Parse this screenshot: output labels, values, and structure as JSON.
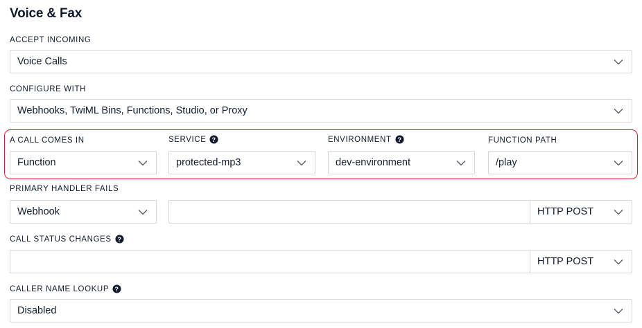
{
  "section_title": "Voice & Fax",
  "accept_incoming": {
    "label": "ACCEPT INCOMING",
    "value": "Voice Calls"
  },
  "configure_with": {
    "label": "CONFIGURE WITH",
    "value": "Webhooks, TwiML Bins, Functions, Studio, or Proxy"
  },
  "call_comes_in": {
    "label": "A CALL COMES IN",
    "value": "Function",
    "service": {
      "label": "SERVICE",
      "value": "protected-mp3"
    },
    "environment": {
      "label": "ENVIRONMENT",
      "value": "dev-environment"
    },
    "function_path": {
      "label": "FUNCTION PATH",
      "value": "/play"
    }
  },
  "primary_handler_fails": {
    "label": "PRIMARY HANDLER FAILS",
    "type": "Webhook",
    "url": "",
    "method": "HTTP POST"
  },
  "call_status_changes": {
    "label": "CALL STATUS CHANGES",
    "url": "",
    "method": "HTTP POST"
  },
  "caller_name_lookup": {
    "label": "CALLER NAME LOOKUP",
    "value": "Disabled"
  },
  "icons": {
    "chevron": "chevron-down-icon",
    "help": "help-circle-icon"
  },
  "colors": {
    "highlight": "#d6212d",
    "border": "#d4d6da",
    "text": "#121c2d"
  }
}
